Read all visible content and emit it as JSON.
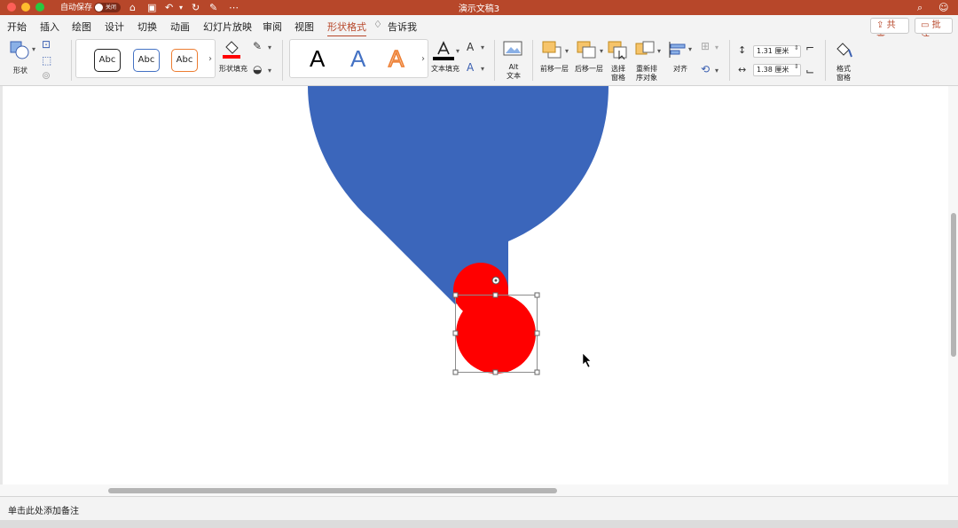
{
  "titlebar": {
    "autosave_label": "自动保存",
    "autosave_state": "关闭",
    "doc_title": "演示文稿3"
  },
  "menu": {
    "tabs": [
      "开始",
      "插入",
      "绘图",
      "设计",
      "切换",
      "动画",
      "幻灯片放映",
      "审阅",
      "视图",
      "形状格式"
    ],
    "active_tab": "形状格式",
    "tell_me": "告诉我",
    "share": "共享",
    "comment": "批注"
  },
  "ribbon": {
    "shape_label": "形状",
    "style_samples": [
      "Abc",
      "Abc",
      "Abc"
    ],
    "fill_label": "形状填充",
    "wordart_samples": [
      "A",
      "A",
      "A"
    ],
    "text_fill_label": "文本填充",
    "alt_text_line1": "Alt",
    "alt_text_line2": "文本",
    "bring_forward": "前移一层",
    "send_backward": "后移一层",
    "selection_pane_line1": "选择",
    "selection_pane_line2": "窗格",
    "reorder_line1": "重新排",
    "reorder_line2": "序对象",
    "align": "对齐",
    "height_value": "1.31 厘米",
    "width_value": "1.38 厘米",
    "format_pane_line1": "格式",
    "format_pane_line2": "窗格"
  },
  "notes": {
    "placeholder": "单击此处添加备注"
  },
  "colors": {
    "accent": "#b7472a",
    "blue_shape": "#3b66bb",
    "red_shape": "#ff0000"
  }
}
